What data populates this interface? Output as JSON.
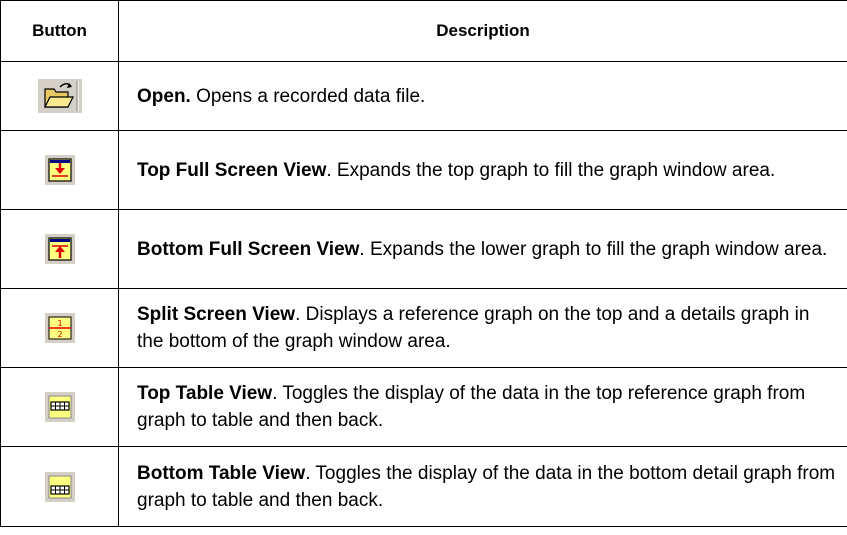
{
  "header": {
    "button": "Button",
    "description": "Description"
  },
  "rows": [
    {
      "icon": "open-folder-icon",
      "term": "Open.",
      "text": " Opens a recorded data file."
    },
    {
      "icon": "top-full-screen-icon",
      "term": "Top Full Screen View",
      "text": ". Expands the top graph to fill the graph window area."
    },
    {
      "icon": "bottom-full-screen-icon",
      "term": "Bottom Full Screen View",
      "text": ". Expands the lower graph to fill the graph window area."
    },
    {
      "icon": "split-screen-icon",
      "term": "Split Screen View",
      "text": ". Displays a reference graph on the top and a details graph in the bottom of the graph window area."
    },
    {
      "icon": "top-table-icon",
      "term": "Top Table View",
      "text": ". Toggles the display of the data in the top reference graph from graph to table and then back."
    },
    {
      "icon": "bottom-table-icon",
      "term": "Bottom Table View",
      "text": ". Toggles the display of the data in the bottom detail graph from graph to table and then back."
    }
  ]
}
